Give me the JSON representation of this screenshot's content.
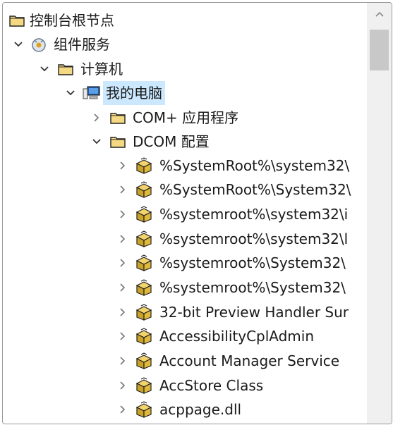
{
  "tree": {
    "root": {
      "label": "控制台根节点"
    },
    "component_services": {
      "label": "组件服务"
    },
    "computers": {
      "label": "计算机"
    },
    "my_computer": {
      "label": "我的电脑"
    },
    "com_plus": {
      "label": "COM+ 应用程序"
    },
    "dcom_config": {
      "label": "DCOM 配置"
    },
    "dcom_items": [
      {
        "label": "%SystemRoot%\\system32\\"
      },
      {
        "label": "%SystemRoot%\\System32\\"
      },
      {
        "label": "%systemroot%\\system32\\i"
      },
      {
        "label": "%systemroot%\\system32\\l"
      },
      {
        "label": "%systemroot%\\System32\\"
      },
      {
        "label": "%systemroot%\\System32\\"
      },
      {
        "label": "32-bit Preview Handler Sur"
      },
      {
        "label": "AccessibilityCplAdmin"
      },
      {
        "label": "Account Manager Service"
      },
      {
        "label": "AccStore Class"
      },
      {
        "label": "acppage.dll"
      }
    ]
  },
  "scrollbar": {
    "position": 0.08
  },
  "icons": {
    "folder": "folder-icon",
    "component_services": "component-services-icon",
    "computer": "computer-icon",
    "dcom_app": "dcom-app-icon",
    "expand": "chevron-right-icon",
    "collapse": "chevron-down-icon",
    "scroll_up": "scroll-up-icon"
  },
  "colors": {
    "selection": "#cce8ff",
    "folder": "#f5d982",
    "dcom_app": "#c9a227"
  }
}
